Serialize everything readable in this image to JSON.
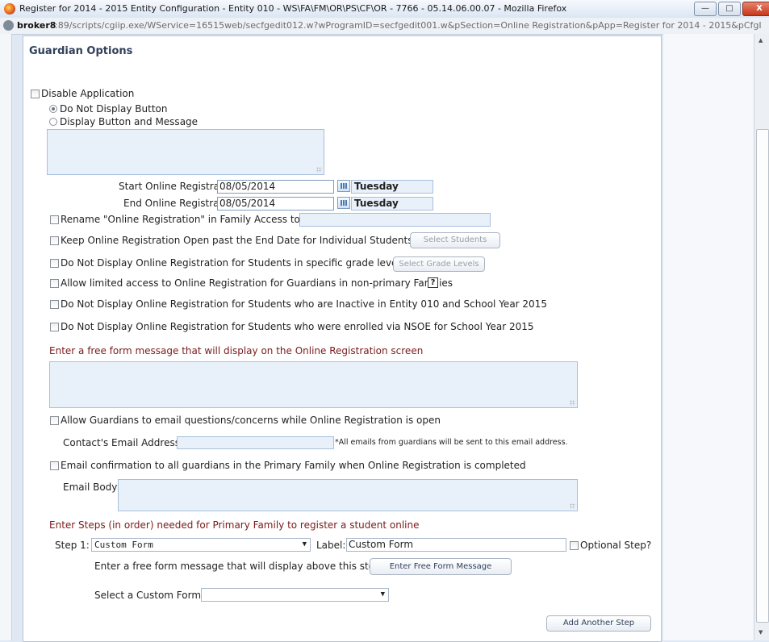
{
  "window": {
    "title": "Register for 2014 - 2015 Entity Configuration - Entity 010 - WS\\FA\\FM\\OR\\PS\\CF\\OR - 7766 - 05.14.06.00.07 - Mozilla Firefox",
    "url_host": "broker8",
    "url_path": ":89/scripts/cgiip.exe/WService=16515web/secfgedit012.w?wProgramID=secfgedit001.w&pSection=Online Registration&pApp=Register for 2014 - 2015&pCfgI",
    "minimize_label": "—",
    "maximize_label": "□",
    "close_label": "X"
  },
  "section": {
    "title": "Guardian Options"
  },
  "disable_app": {
    "label": "Disable Application",
    "radio1": "Do Not Display Button",
    "radio2": "Display Button and Message"
  },
  "dates": {
    "start_label": "Start Online Registration on:",
    "start_value": "08/05/2014",
    "start_day": "Tuesday",
    "end_label": "End Online Registration on:",
    "end_value": "08/05/2014",
    "end_day": "Tuesday"
  },
  "options": {
    "rename": "Rename \"Online Registration\" in Family Access to:",
    "keep_open": "Keep Online Registration Open past the End Date for Individual Students",
    "select_students": "Select Students",
    "grade_levels": "Do Not Display Online Registration for Students in specific grade levels",
    "select_grade_levels": "Select Grade Levels",
    "limited_access": "Allow limited access to Online Registration for Guardians in non-primary Families",
    "help": "?",
    "inactive": "Do Not Display Online Registration for Students who are Inactive in Entity 010 and School Year 2015",
    "nsoe": "Do Not Display Online Registration for Students who were enrolled via NSOE for School Year 2015"
  },
  "free_form": {
    "label": "Enter a free form message that will display on the Online Registration screen"
  },
  "email": {
    "allow": "Allow Guardians to email questions/concerns while Online Registration is open",
    "contact_label": "Contact's Email Address:",
    "contact_note": "*All emails from guardians will be sent to this email address.",
    "confirm": "Email confirmation to all guardians in the Primary Family when Online Registration is completed",
    "body_label": "Email Body:"
  },
  "steps": {
    "label": "Enter Steps (in order) needed for Primary Family to register a student online",
    "step1_label": "Step 1:",
    "step1_value": "Custom Form",
    "label_label": "Label:",
    "label_value": "Custom Form",
    "optional": "Optional Step?",
    "free_form_label": "Enter a free form message that will display above this step:",
    "free_form_button": "Enter Free Form Message",
    "custom_form_label": "Select a Custom Form:",
    "custom_form_value": "",
    "add_step": "Add Another Step"
  }
}
